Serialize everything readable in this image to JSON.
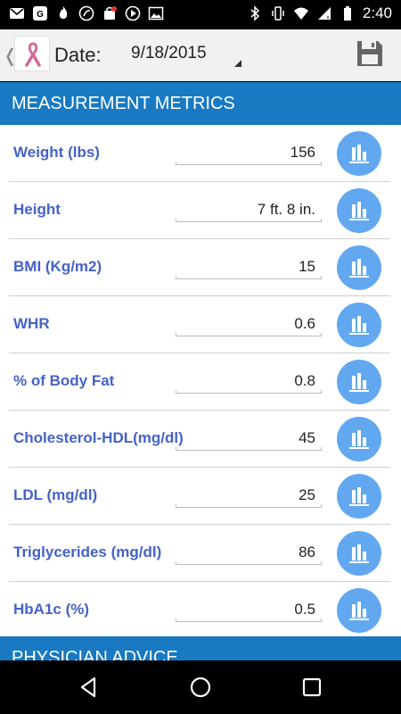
{
  "status_bar": {
    "time": "2:40"
  },
  "app_bar": {
    "date_label": "Date:",
    "date_value": "9/18/2015"
  },
  "sections": {
    "measurement_title": "MEASUREMENT METRICS",
    "physician_title": "PHYSICIAN ADVICE"
  },
  "metrics": [
    {
      "label": "Weight (lbs)",
      "value": "156"
    },
    {
      "label": "Height",
      "value": "7 ft. 8 in."
    },
    {
      "label": "BMI (Kg/m2)",
      "value": "15"
    },
    {
      "label": "WHR",
      "value": "0.6"
    },
    {
      "label": "% of Body Fat",
      "value": "0.8"
    },
    {
      "label": "Cholesterol-HDL(mg/dl)",
      "value": "45"
    },
    {
      "label": "LDL (mg/dl)",
      "value": "25"
    },
    {
      "label": "Triglycerides (mg/dl)",
      "value": "86"
    },
    {
      "label": "HbA1c (%)",
      "value": "0.5"
    }
  ],
  "colors": {
    "accent": "#1979c2",
    "chart_button": "#61a8f1",
    "label": "#4562c9"
  },
  "icons": [
    "chart-bars-icon",
    "save-floppy-icon",
    "ribbon-logo-icon",
    "back-icon",
    "home-icon",
    "recents-icon"
  ]
}
